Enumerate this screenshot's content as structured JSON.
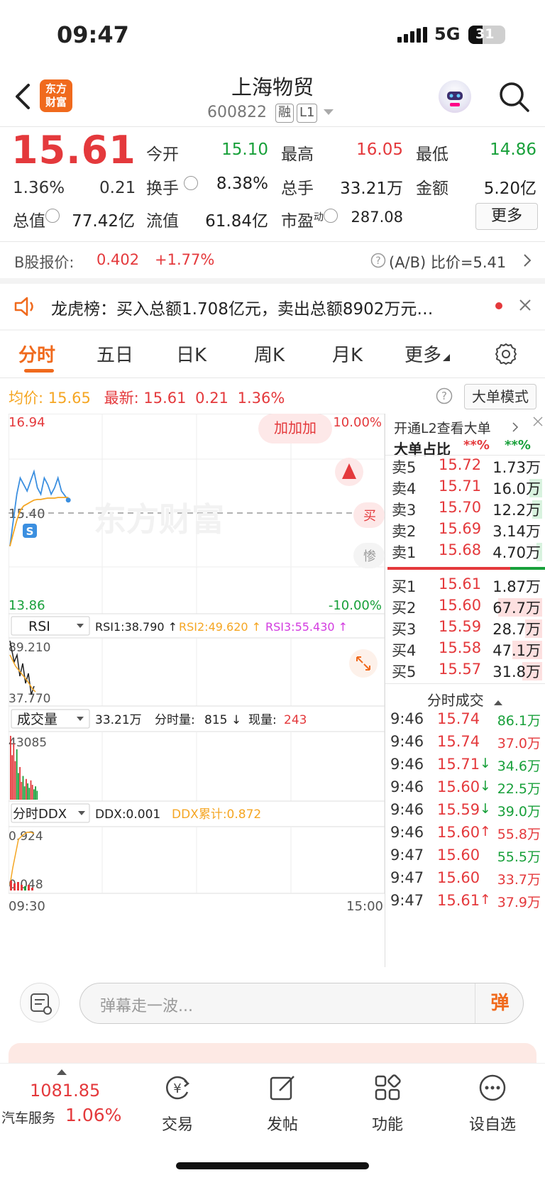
{
  "status_bar": {
    "time": "09:47",
    "network": "5G",
    "battery": "31"
  },
  "header": {
    "stock_name": "上海物贸",
    "stock_code": "600822",
    "tag_margin": "融",
    "tag_level": "L1",
    "logo_line1": "东方",
    "logo_line2": "财富"
  },
  "quote": {
    "price": "15.61",
    "change_pct": "1.36%",
    "change_amt": "0.21",
    "open_label": "今开",
    "open": "15.10",
    "high_label": "最高",
    "high": "16.05",
    "low_label": "最低",
    "low": "14.86",
    "turnover_label": "换手",
    "turnover": "8.38%",
    "volume_label": "总手",
    "volume": "33.21万",
    "amount_label": "金额",
    "amount": "5.20亿",
    "mktcap_label": "总值",
    "mktcap": "77.42亿",
    "float_label": "流值",
    "float": "61.84亿",
    "pe_label": "市盈",
    "pe_sup": "动",
    "pe": "287.08",
    "more_label": "更多"
  },
  "bshare": {
    "label": "B股报价:",
    "price": "0.402",
    "change": "+1.77%",
    "ratio_label": "(A/B) 比价=5.41"
  },
  "notice": {
    "text": "龙虎榜：买入总额1.708亿元，卖出总额8902万元…"
  },
  "tabs": [
    "分时",
    "五日",
    "日K",
    "周K",
    "月K",
    "更多"
  ],
  "info_line": {
    "avg_label": "均价:",
    "avg": "15.65",
    "latest_label": "最新:",
    "latest": "15.61",
    "chg": "0.21",
    "pct": "1.36%",
    "mode_button": "大单模式"
  },
  "chart_labels": {
    "price_high": "16.94",
    "price_low": "13.86",
    "price_mid": "15.40",
    "pct_high": "10.00%",
    "pct_low": "-10.00%",
    "bubble": "加加加",
    "watermark": "东方财富",
    "side_buy": "买",
    "side_sell": "惨",
    "rsi_selector": "RSI",
    "rsi1": "RSI1:38.790 ↑",
    "rsi2": "RSI2:49.620 ↑",
    "rsi3": "RSI3:55.430 ↑",
    "rsi_top": "89.210",
    "rsi_bottom": "37.770",
    "vol_selector": "成交量",
    "vol_total": "33.21万",
    "vol_period_label": "分时量:",
    "vol_period": "815 ↓",
    "vol_now_label": "现量:",
    "vol_now": "243",
    "vol_max": "43085",
    "ddx_selector": "分时DDX",
    "ddx": "DDX:0.001",
    "ddx_cum": "DDX累计:0.872",
    "ddx_top": "0.924",
    "ddx_bottom": "0.048",
    "time_start": "09:30",
    "time_end": "15:00"
  },
  "chart_data": {
    "type": "line",
    "title": "",
    "xlabel": "",
    "ylabel": "",
    "x": [
      "09:30",
      "09:31",
      "09:32",
      "09:33",
      "09:34",
      "09:35",
      "09:36",
      "09:37",
      "09:38",
      "09:39",
      "09:40",
      "09:41",
      "09:42",
      "09:43",
      "09:44",
      "09:45",
      "09:46",
      "09:47"
    ],
    "ylim": [
      13.86,
      16.94
    ],
    "series": [
      {
        "values": [
          14.9,
          15.3,
          15.7,
          15.95,
          15.85,
          15.75,
          15.9,
          16.05,
          15.8,
          15.7,
          15.95,
          15.85,
          15.7,
          15.8,
          15.95,
          15.75,
          15.68,
          15.61
        ]
      },
      {
        "values": [
          14.9,
          15.1,
          15.3,
          15.45,
          15.52,
          15.55,
          15.58,
          15.61,
          15.62,
          15.62,
          15.63,
          15.64,
          15.64,
          15.64,
          15.65,
          15.65,
          15.65,
          15.65
        ]
      }
    ],
    "volumes": [
      43085,
      30000,
      38000,
      26000,
      34000,
      18000,
      22000,
      12000,
      16000,
      9000,
      14000,
      11000,
      8000,
      13000,
      10000,
      7000,
      9000,
      6000
    ]
  },
  "order_book": {
    "l2_promo": "开通L2查看大单",
    "big_ratio_label": "大单占比",
    "big_ratio_buy": "**%",
    "big_ratio_sell": "**%",
    "sells": [
      {
        "label": "卖5",
        "price": "15.72",
        "vol": "1.73万"
      },
      {
        "label": "卖4",
        "price": "15.71",
        "vol": "16.0万"
      },
      {
        "label": "卖3",
        "price": "15.70",
        "vol": "12.2万"
      },
      {
        "label": "卖2",
        "price": "15.69",
        "vol": "3.14万"
      },
      {
        "label": "卖1",
        "price": "15.68",
        "vol": "4.70万"
      }
    ],
    "buys": [
      {
        "label": "买1",
        "price": "15.61",
        "vol": "1.87万"
      },
      {
        "label": "买2",
        "price": "15.60",
        "vol": "67.7万"
      },
      {
        "label": "买3",
        "price": "15.59",
        "vol": "28.7万"
      },
      {
        "label": "买4",
        "price": "15.58",
        "vol": "47.1万"
      },
      {
        "label": "买5",
        "price": "15.57",
        "vol": "31.8万"
      }
    ],
    "ticks_label": "分时成交",
    "ticks": [
      {
        "time": "9:46",
        "price": "15.74",
        "vol": "86.1万",
        "dir": ""
      },
      {
        "time": "9:46",
        "price": "15.74",
        "vol": "37.0万",
        "dir": ""
      },
      {
        "time": "9:46",
        "price": "15.71",
        "vol": "34.6万",
        "dir": "↓"
      },
      {
        "time": "9:46",
        "price": "15.60",
        "vol": "22.5万",
        "dir": "↓"
      },
      {
        "time": "9:46",
        "price": "15.59",
        "vol": "39.0万",
        "dir": "↓"
      },
      {
        "time": "9:46",
        "price": "15.60",
        "vol": "55.8万",
        "dir": "↑"
      },
      {
        "time": "9:47",
        "price": "15.60",
        "vol": "55.5万",
        "dir": ""
      },
      {
        "time": "9:47",
        "price": "15.60",
        "vol": "33.7万",
        "dir": ""
      },
      {
        "time": "9:47",
        "price": "15.61",
        "vol": "37.9万",
        "dir": "↑"
      }
    ]
  },
  "danmu": {
    "placeholder": "弹幕走一波...",
    "send": "弹"
  },
  "bottom_nav": {
    "index_value": "1081.85",
    "index_name": "汽车服务",
    "index_pct": "1.06%",
    "items": [
      "交易",
      "发帖",
      "功能",
      "设自选"
    ]
  }
}
